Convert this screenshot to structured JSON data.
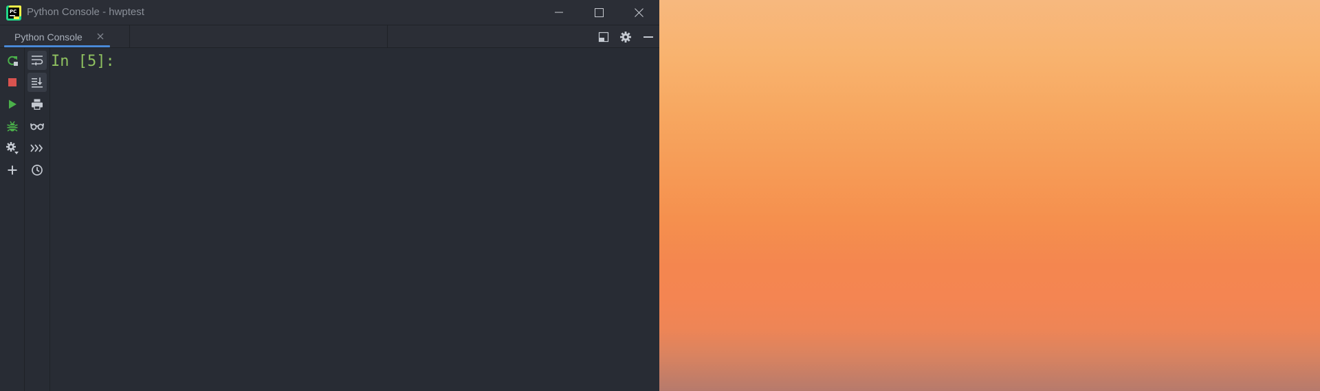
{
  "window": {
    "title": "Python Console - hwptest"
  },
  "tabs": [
    {
      "label": "Python Console",
      "active": true
    }
  ],
  "console": {
    "prompt": "In [5]:"
  },
  "colors": {
    "window_bg": "#282c34",
    "titlebar_bg": "#2b2e36",
    "accent": "#4a8ad8",
    "prompt_green": "#8fc160",
    "run_green": "#4bb14a",
    "stop_red": "#d9534f",
    "icon_gray": "#c5cad2"
  },
  "toolbar_left": [
    {
      "icon": "rerun-icon"
    },
    {
      "icon": "stop-icon"
    },
    {
      "icon": "run-icon"
    },
    {
      "icon": "debug-icon"
    },
    {
      "icon": "settings-icon"
    },
    {
      "icon": "add-icon"
    }
  ],
  "toolbar_second": [
    {
      "icon": "soft-wrap-icon",
      "active": true
    },
    {
      "icon": "scroll-to-end-icon",
      "active": true
    },
    {
      "icon": "print-icon"
    },
    {
      "icon": "show-variables-icon"
    },
    {
      "icon": "execute-in-console-icon"
    },
    {
      "icon": "history-icon"
    }
  ]
}
